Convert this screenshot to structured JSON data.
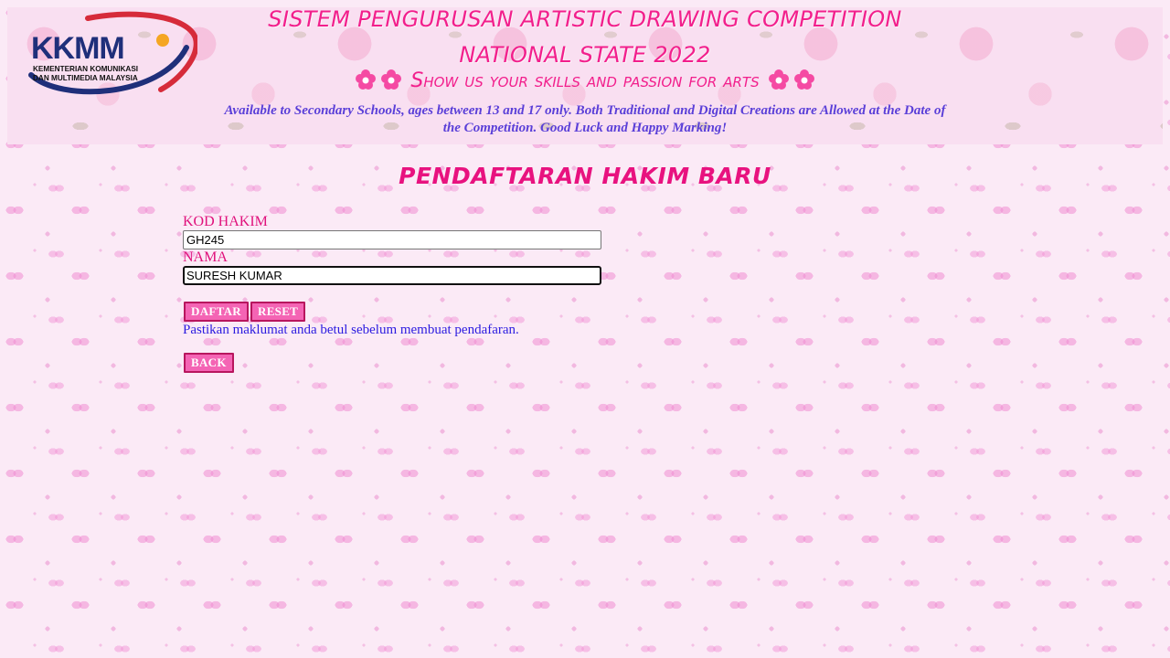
{
  "banner": {
    "logo": {
      "brand": "KKMM",
      "org_line_1": "KEMENTERIAN KOMUNIKASI",
      "org_line_2": "DAN MULTIMEDIA MALAYSIA"
    },
    "title_line_1": "SISTEM PENGURUSAN ARTISTIC DRAWING COMPETITION",
    "title_line_2": "NATIONAL STATE 2022",
    "slogan": "Show us your skills and passion for arts",
    "description": "Available to Secondary Schools, ages between 13 and 17 only. Both Traditional and Digital Creations are Allowed at the Date of the Competition. Good Luck and Happy Marking!",
    "flower_icon": "flower-icon"
  },
  "page": {
    "title": "PENDAFTARAN HAKIM BARU"
  },
  "form": {
    "kod_hakim": {
      "label": "KOD HAKIM",
      "value": "GH245"
    },
    "nama": {
      "label": "NAMA",
      "value": "SURESH KUMAR "
    },
    "daftar_label": "DAFTAR",
    "reset_label": "RESET",
    "hint": "Pastikan maklumat anda betul sebelum membuat pendafaran.",
    "back_label": "BACK"
  },
  "colors": {
    "accent_pink": "#f21f8c",
    "button_fill": "#f464b4",
    "button_border": "#b8165e",
    "hint_blue": "#2b1be0",
    "description_purple": "#5a3fd8",
    "logo_navy": "#1f2f7a",
    "logo_red": "#d62b3a",
    "logo_orange": "#f5a623"
  }
}
